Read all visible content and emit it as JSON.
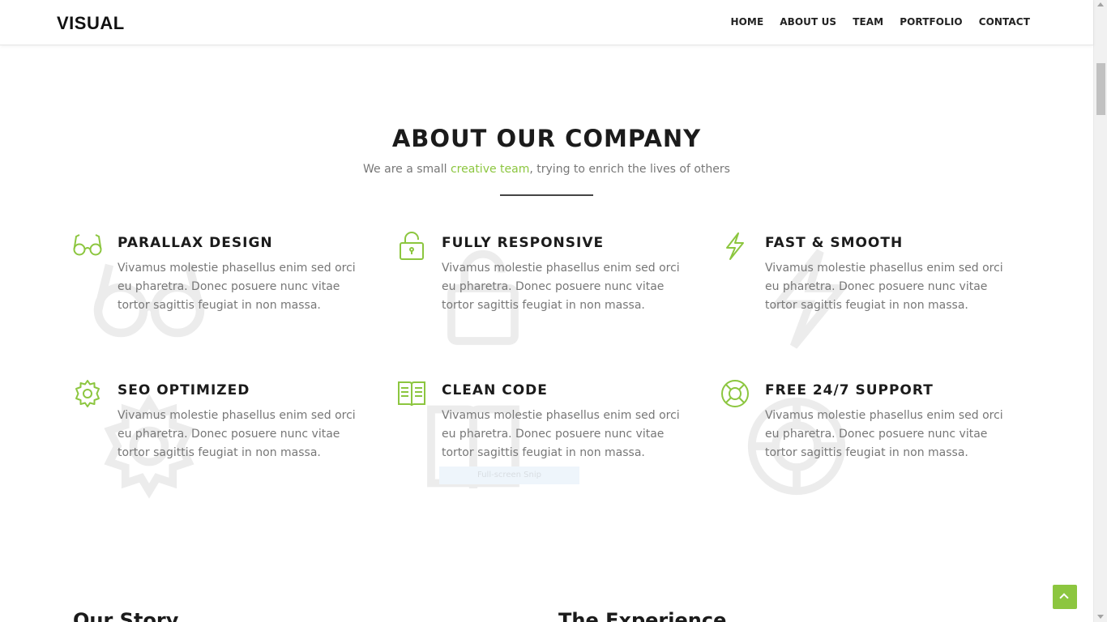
{
  "brand": {
    "logo": "VISUAL",
    "accent_color": "#8cc63f"
  },
  "nav": {
    "items": [
      "HOME",
      "ABOUT US",
      "TEAM",
      "PORTFOLIO",
      "CONTACT"
    ]
  },
  "about": {
    "title": "ABOUT OUR COMPANY",
    "subtitle_before": "We are a small ",
    "subtitle_accent": "creative team",
    "subtitle_after": ", trying to enrich the lives of others"
  },
  "features": [
    {
      "icon": "glasses-icon",
      "title": "PARALLAX DESIGN",
      "text": "Vivamus molestie phasellus enim sed orci eu pharetra. Donec posuere nunc vitae tortor sagittis feugiat in non massa."
    },
    {
      "icon": "unlock-icon",
      "title": "FULLY RESPONSIVE",
      "text": "Vivamus molestie phasellus enim sed orci eu pharetra. Donec posuere nunc vitae tortor sagittis feugiat in non massa."
    },
    {
      "icon": "lightning-icon",
      "title": "FAST & SMOOTH",
      "text": "Vivamus molestie phasellus enim sed orci eu pharetra. Donec posuere nunc vitae tortor sagittis feugiat in non massa."
    },
    {
      "icon": "gear-icon",
      "title": "SEO OPTIMIZED",
      "text": "Vivamus molestie phasellus enim sed orci eu pharetra. Donec posuere nunc vitae tortor sagittis feugiat in non massa."
    },
    {
      "icon": "book-icon",
      "title": "CLEAN CODE",
      "text": "Vivamus molestie phasellus enim sed orci eu pharetra. Donec posuere nunc vitae tortor sagittis feugiat in non massa."
    },
    {
      "icon": "lifebuoy-icon",
      "title": "FREE 24/7 SUPPORT",
      "text": "Vivamus molestie phasellus enim sed orci eu pharetra. Donec posuere nunc vitae tortor sagittis feugiat in non massa."
    }
  ],
  "overlay": {
    "snip_label": "Full-screen Snip"
  },
  "bottom": {
    "left_heading": "Our Story",
    "right_heading": "The Experience"
  }
}
